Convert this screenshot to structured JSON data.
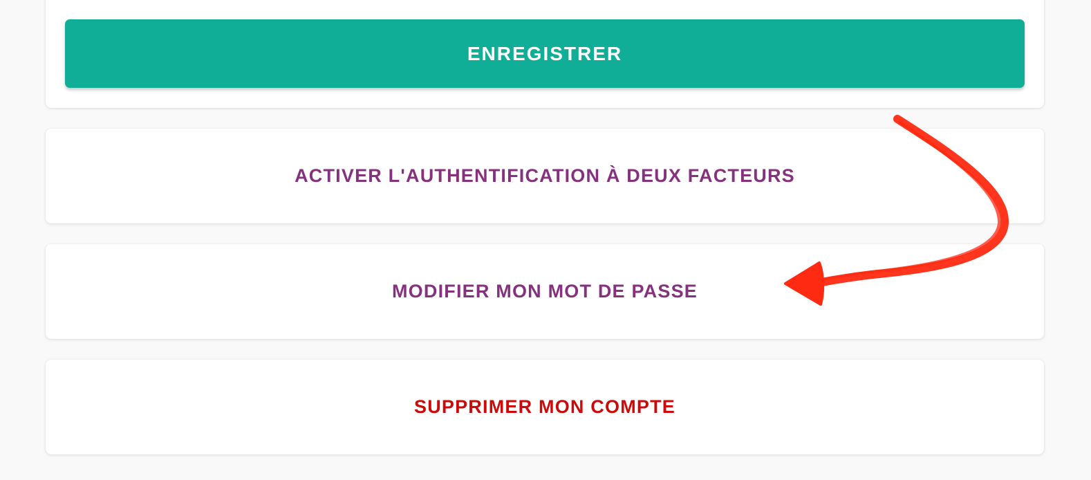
{
  "save_button": {
    "label": "ENREGISTRER",
    "color": "#10ae96"
  },
  "actions": {
    "enable_2fa_label": "ACTIVER L'AUTHENTIFICATION À DEUX FACTEURS",
    "change_password_label": "MODIFIER MON MOT DE PASSE",
    "delete_account_label": "SUPPRIMER MON COMPTE"
  },
  "colors": {
    "action_text": "#86317e",
    "danger_text": "#cc0a0a",
    "annotation_arrow": "#ff2a12"
  },
  "annotation": {
    "icon": "arrow-icon"
  }
}
